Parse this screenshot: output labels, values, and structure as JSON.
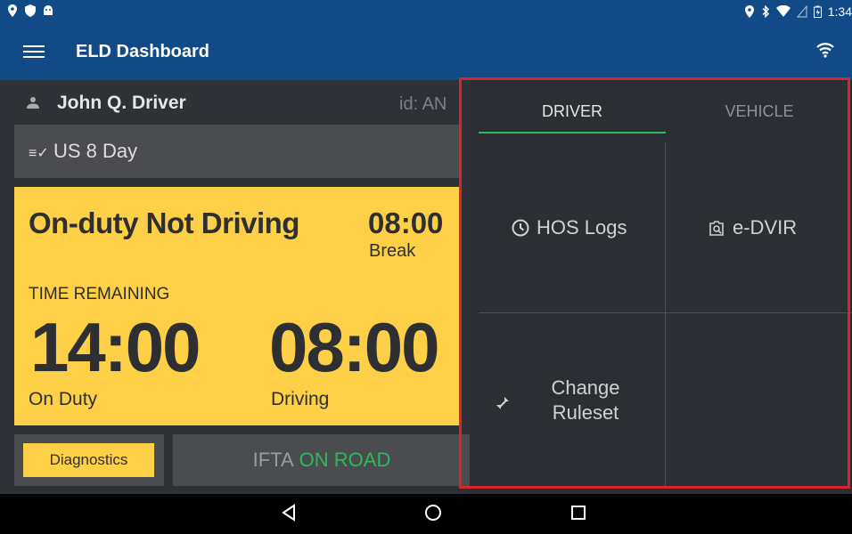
{
  "status_bar": {
    "time": "1:34",
    "left_icons": [
      "location-icon",
      "shield-icon",
      "android-icon"
    ],
    "right_icons": [
      "location-icon",
      "bluetooth-icon",
      "wifi-signal-icon",
      "no-sim-icon",
      "battery-icon"
    ]
  },
  "app_bar": {
    "title": "ELD Dashboard",
    "menu_icon": "hamburger-menu-icon",
    "connection_icon": "wifi-icon"
  },
  "driver": {
    "name": "John Q. Driver",
    "id": "id: AN"
  },
  "ruleset": {
    "label": "US 8 Day"
  },
  "status_card": {
    "status": "On-duty Not Driving",
    "break_time": "08:00",
    "break_label": "Break",
    "remaining_label": "TIME REMAINING",
    "on_duty_time": "14:00",
    "on_duty_label": "On Duty",
    "driving_time": "08:00",
    "driving_label": "Driving"
  },
  "footer": {
    "diagnostics_label": "Diagnostics",
    "ifta_label": "IFTA",
    "ifta_status": "ON ROAD"
  },
  "panel": {
    "tabs": [
      {
        "label": "DRIVER",
        "active": true
      },
      {
        "label": "VEHICLE",
        "active": false
      }
    ],
    "tiles": {
      "hos_logs": "HOS Logs",
      "e_dvir": "e-DVIR",
      "change_ruleset_line1": "Change",
      "change_ruleset_line2": "Ruleset"
    }
  },
  "colors": {
    "app_bar": "#114a87",
    "accent_yellow": "#fdd048",
    "accent_green": "#2fb85f",
    "panel_dark": "#2b2e33",
    "highlight_red": "#d9242b"
  }
}
